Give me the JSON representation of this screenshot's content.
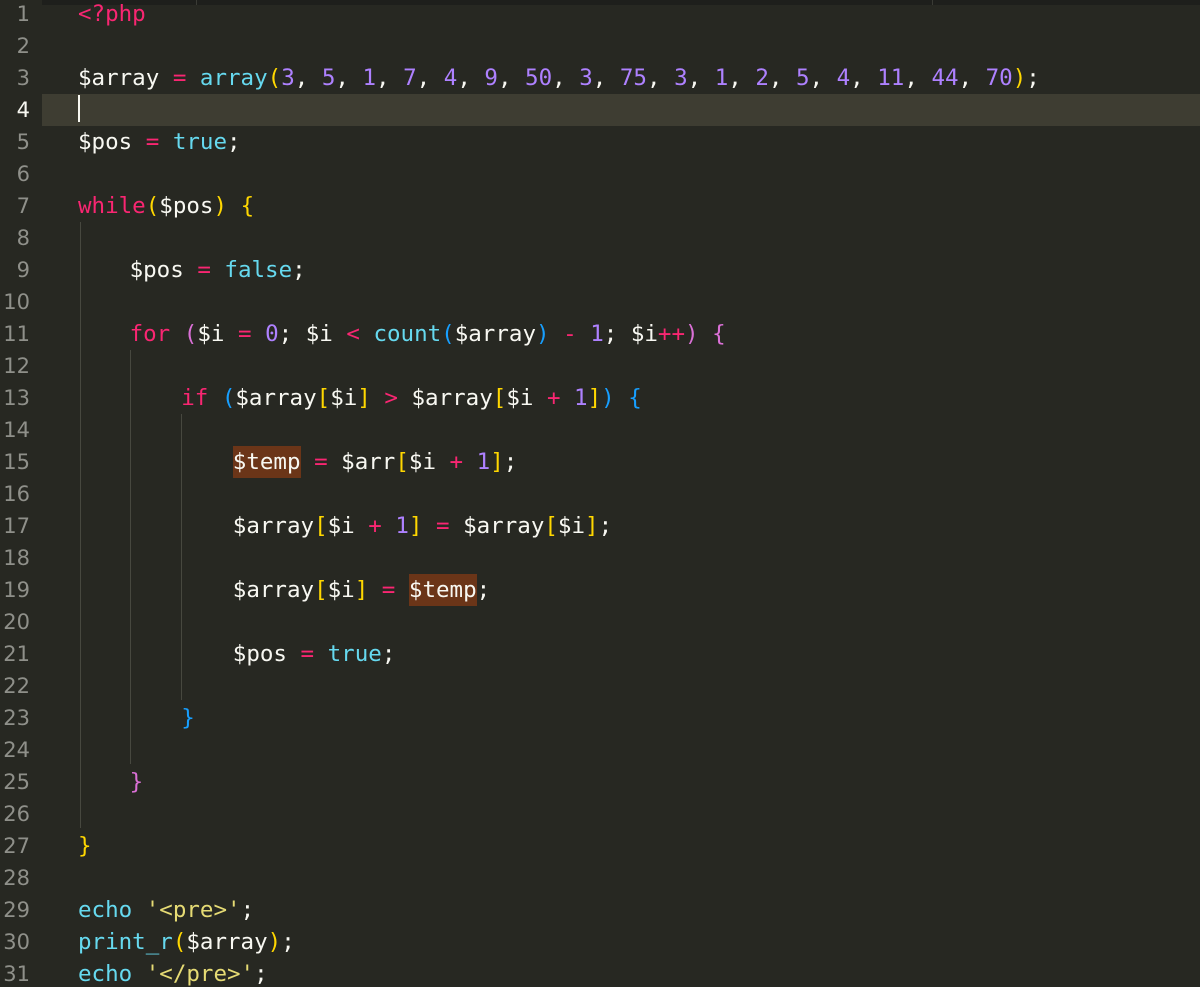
{
  "editor": {
    "current_line": 4,
    "line_numbers": [
      "1",
      "2",
      "3",
      "4",
      "5",
      "6",
      "7",
      "8",
      "9",
      "10",
      "11",
      "12",
      "13",
      "14",
      "15",
      "16",
      "17",
      "18",
      "19",
      "20",
      "21",
      "22",
      "23",
      "24",
      "25",
      "26",
      "27",
      "28",
      "29",
      "30",
      "31"
    ],
    "code": {
      "l1": [
        "<?php"
      ],
      "l3": [
        "$array",
        " = ",
        "array",
        "(",
        "3",
        ", ",
        "5",
        ", ",
        "1",
        ", ",
        "7",
        ", ",
        "4",
        ", ",
        "9",
        ", ",
        "50",
        ", ",
        "3",
        ", ",
        "75",
        ", ",
        "3",
        ", ",
        "1",
        ", ",
        "2",
        ", ",
        "5",
        ", ",
        "4",
        ", ",
        "11",
        ", ",
        "44",
        ", ",
        "70",
        ")",
        ";"
      ],
      "l5": [
        "$pos",
        " = ",
        "true",
        ";"
      ],
      "l7": [
        "while",
        "(",
        "$pos",
        ")",
        " ",
        "{"
      ],
      "l9": [
        "$pos",
        " = ",
        "false",
        ";"
      ],
      "l11": [
        "for",
        " ",
        "(",
        "$i",
        " = ",
        "0",
        "; ",
        "$i",
        " < ",
        "count",
        "(",
        "$array",
        ")",
        " - ",
        "1",
        "; ",
        "$i",
        "++",
        ")",
        " ",
        "{"
      ],
      "l13": [
        "if",
        " ",
        "(",
        "$array",
        "[",
        "$i",
        "]",
        " > ",
        "$array",
        "[",
        "$i",
        " + ",
        "1",
        "]",
        ")",
        " ",
        "{"
      ],
      "l15": [
        "$temp",
        " = ",
        "$arr",
        "[",
        "$i",
        " + ",
        "1",
        "]",
        ";"
      ],
      "l17": [
        "$array",
        "[",
        "$i",
        " + ",
        "1",
        "]",
        " = ",
        "$array",
        "[",
        "$i",
        "]",
        ";"
      ],
      "l19": [
        "$array",
        "[",
        "$i",
        "]",
        " = ",
        "$temp",
        ";"
      ],
      "l21": [
        "$pos",
        " = ",
        "true",
        ";"
      ],
      "l23": [
        "}"
      ],
      "l25": [
        "}"
      ],
      "l27": [
        "}"
      ],
      "l29": [
        "echo",
        " ",
        "'<pre>'",
        ";"
      ],
      "l30": [
        "print_r",
        "(",
        "$array",
        ")",
        ";"
      ],
      "l31": [
        "echo",
        " ",
        "'</pre>'",
        ";"
      ]
    }
  },
  "colors": {
    "background": "#272822",
    "current_line": "#3e3d32",
    "keyword": "#f92672",
    "function": "#66d9ef",
    "number": "#ae81ff",
    "string": "#e6db74",
    "bracket_level1": "#ffd700",
    "bracket_level2": "#da70d6",
    "bracket_level3": "#179fff",
    "word_highlight": "#6b3518"
  }
}
